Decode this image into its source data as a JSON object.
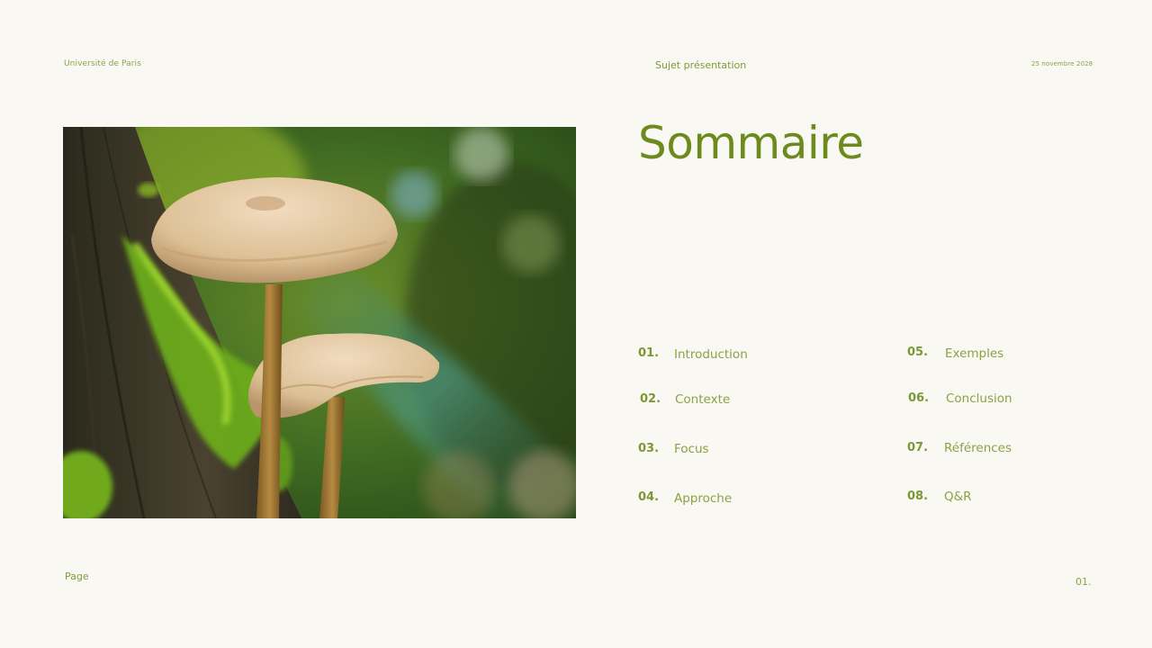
{
  "header": {
    "left": "Université de Paris",
    "center": "Sujet présentation",
    "right": "25 novembre 2028"
  },
  "title": "Sommaire",
  "photo": {
    "icon": "mushroom-photo"
  },
  "toc": [
    {
      "num": "01.",
      "label": "Introduction"
    },
    {
      "num": "02.",
      "label": "Contexte"
    },
    {
      "num": "03.",
      "label": "Focus"
    },
    {
      "num": "04.",
      "label": "Approche"
    },
    {
      "num": "05.",
      "label": "Exemples"
    },
    {
      "num": "06.",
      "label": "Conclusion"
    },
    {
      "num": "07.",
      "label": "Références"
    },
    {
      "num": "08.",
      "label": "Q&R"
    }
  ],
  "footer": {
    "left": "Page",
    "right": "01."
  },
  "colors": {
    "background": "#f9f8f3",
    "accent": "#6d8a1e",
    "text": "#8aa246"
  }
}
